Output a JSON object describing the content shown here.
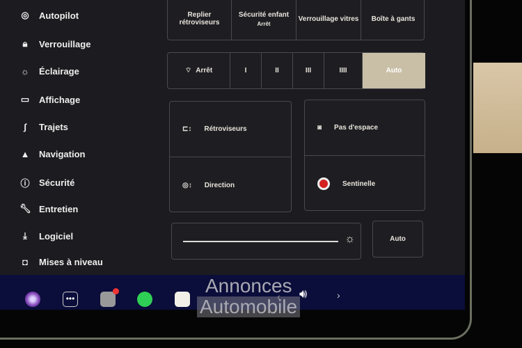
{
  "sidebar": {
    "items": [
      {
        "label": "Autopilot",
        "icon": "steering-wheel-icon"
      },
      {
        "label": "Verrouillage",
        "icon": "lock-icon"
      },
      {
        "label": "Éclairage",
        "icon": "sun-icon"
      },
      {
        "label": "Affichage",
        "icon": "display-icon"
      },
      {
        "label": "Trajets",
        "icon": "trips-icon"
      },
      {
        "label": "Navigation",
        "icon": "navigation-arrow-icon"
      },
      {
        "label": "Sécurité",
        "icon": "info-circle-icon"
      },
      {
        "label": "Entretien",
        "icon": "wrench-icon"
      },
      {
        "label": "Logiciel",
        "icon": "download-icon"
      },
      {
        "label": "Mises à niveau",
        "icon": "shopping-bag-icon"
      }
    ]
  },
  "controls": {
    "top": [
      {
        "label": "Replier rétroviseurs"
      },
      {
        "label": "Sécurité enfant",
        "sub": "Arrêt"
      },
      {
        "label": "Verrouillage vitres"
      },
      {
        "label": "Boîte à gants"
      }
    ],
    "wipers": {
      "off": "Arrêt",
      "levels": [
        "I",
        "II",
        "III",
        "IIII"
      ],
      "auto": "Auto",
      "selected": "Auto"
    },
    "mirrors": "Rétroviseurs",
    "steering": "Direction",
    "no_space": "Pas d'espace",
    "sentry": "Sentinelle",
    "brightness": {
      "level_percent": 95,
      "auto": "Auto"
    }
  },
  "colors": {
    "selected": "#c9bfa6",
    "taskbar": "#0b0d3a",
    "sentry": "#d42020"
  },
  "taskbar": {
    "icons": [
      "camera-lens-icon",
      "more-dots-icon",
      "dashcam-icon",
      "spotify-icon",
      "calendar-icon",
      "volume-icon"
    ],
    "prev": "‹",
    "next": "›"
  },
  "watermark": {
    "line1": "Annonces",
    "line2": "Automobile"
  }
}
